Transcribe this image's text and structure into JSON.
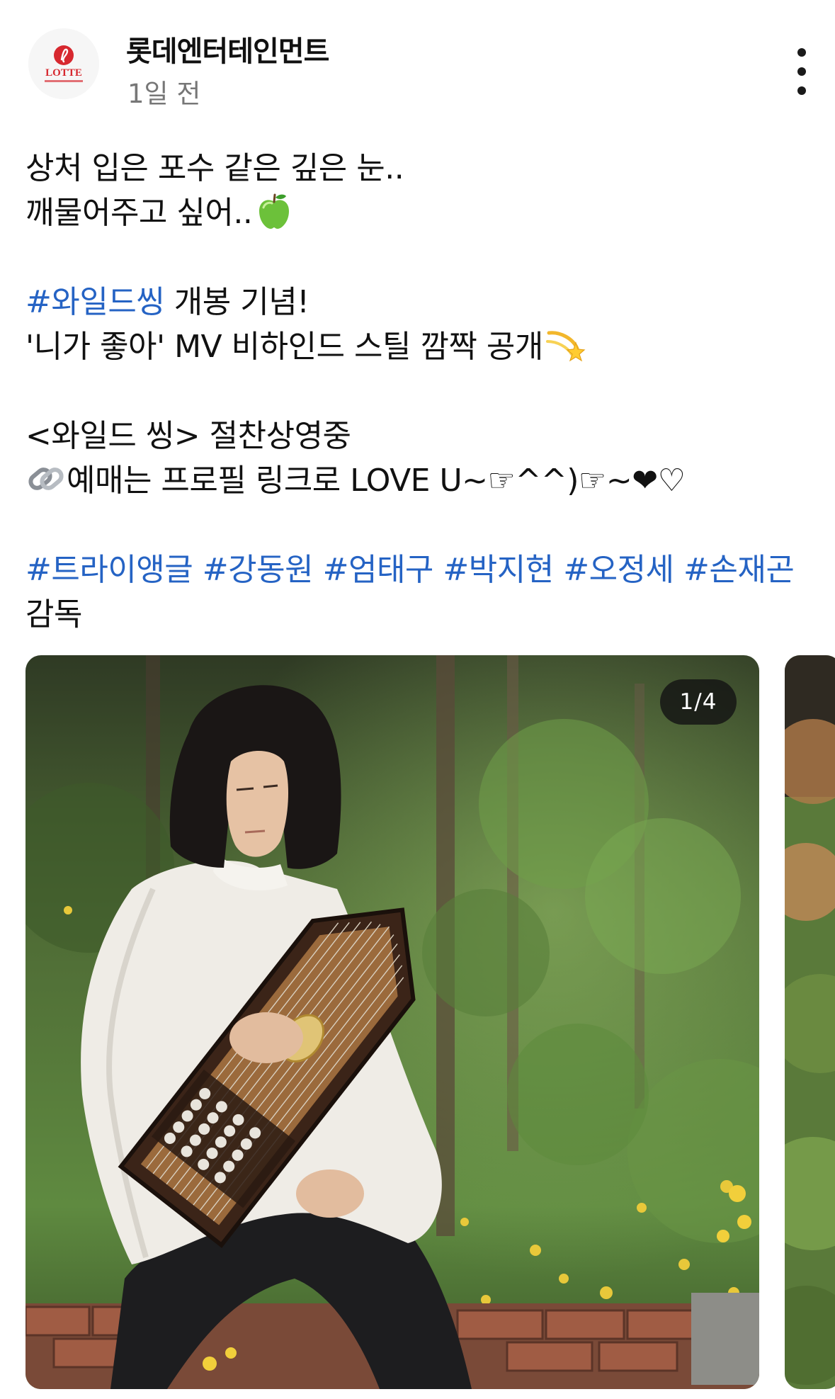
{
  "post": {
    "author": "롯데엔터테인먼트",
    "time": "1일 전",
    "logo_text": "LOTTE"
  },
  "caption": {
    "line1": "상처 입은 포수 같은 깊은 눈..",
    "line2": "깨물어주고 싶어..",
    "line2_emoji": "green-apple",
    "line3_tag": "#와일드씽",
    "line3_rest": " 개봉 기념!",
    "line4": "'니가 좋아' MV 비하인드 스틸 깜짝 공개",
    "line4_emoji": "dizzy",
    "line5": "<와일드 씽> 절찬상영중",
    "line6_emoji": "link",
    "line6": "예매는 프로필 링크로 LOVE U~☞^^)☞~",
    "line6_end": "❤︎♡",
    "tags": [
      "#트라이앵글",
      "#강동원",
      "#엄태구",
      "#박지현",
      "#오정세",
      "#손재곤"
    ],
    "line8": "감독"
  },
  "media": {
    "counter": "1/4",
    "current_index": 1,
    "total": 4
  },
  "colors": {
    "hashtag": "#2563c4",
    "text": "#111111",
    "secondary": "#777777",
    "logo_red": "#d7282f"
  }
}
